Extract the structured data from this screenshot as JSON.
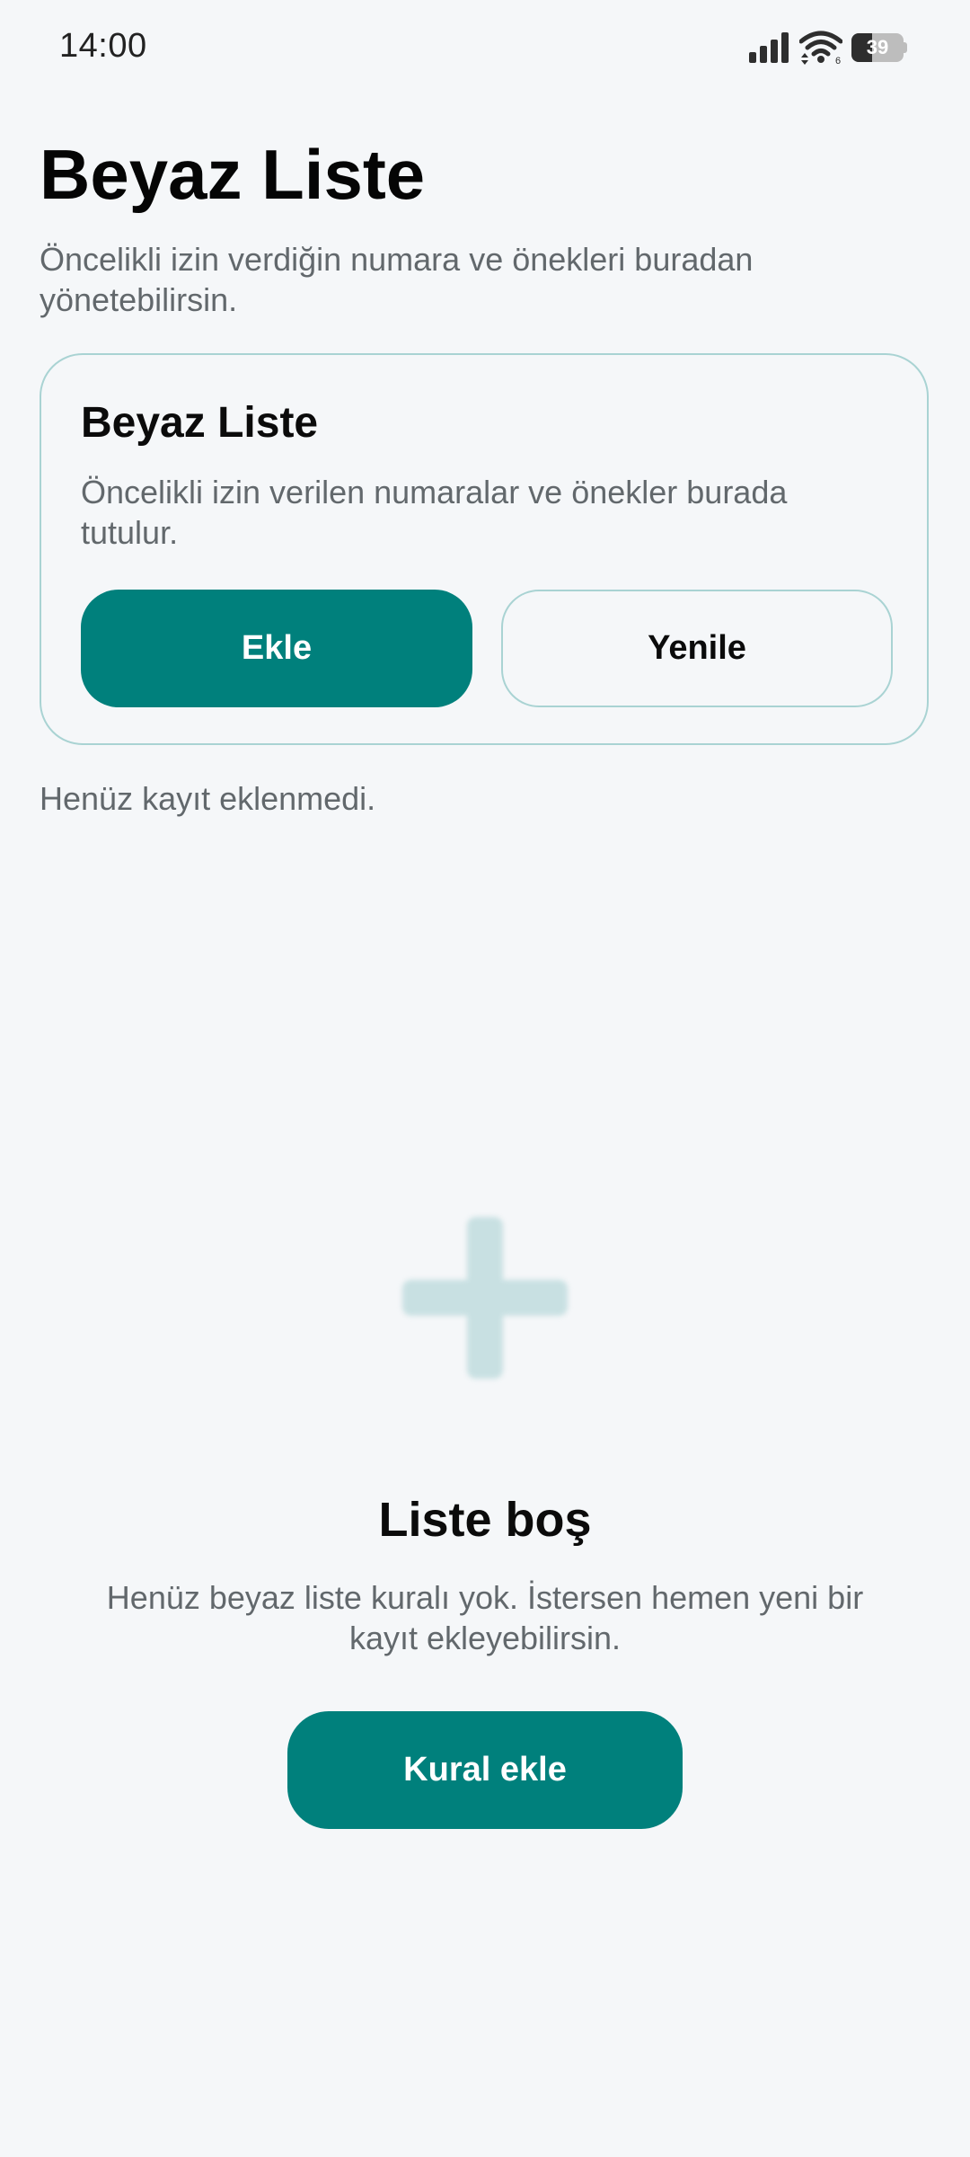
{
  "status_bar": {
    "time": "14:00",
    "battery_level": "39",
    "battery_fraction": 0.39,
    "icons": [
      "signal-icon",
      "wifi-icon",
      "battery-icon"
    ]
  },
  "header": {
    "title": "Beyaz Liste",
    "subtitle": "Öncelikli izin verdiğin numara ve önekleri buradan yönetebilirsin."
  },
  "card": {
    "title": "Beyaz Liste",
    "description": "Öncelikli izin verilen numaralar ve önekler burada tutulur.",
    "add_label": "Ekle",
    "refresh_label": "Yenile"
  },
  "list": {
    "empty_note": "Henüz kayıt eklenmedi."
  },
  "empty_state": {
    "icon": "plus-icon",
    "title": "Liste boş",
    "description": "Henüz beyaz liste kuralı yok. İstersen hemen yeni bir kayıt ekleyebilirsin.",
    "button_label": "Kural ekle"
  },
  "colors": {
    "accent": "#00807c",
    "background": "#f5f7f9",
    "card_border": "#a9d3d3",
    "muted_text": "#62686c",
    "plus_icon": "#c8e0e2"
  }
}
